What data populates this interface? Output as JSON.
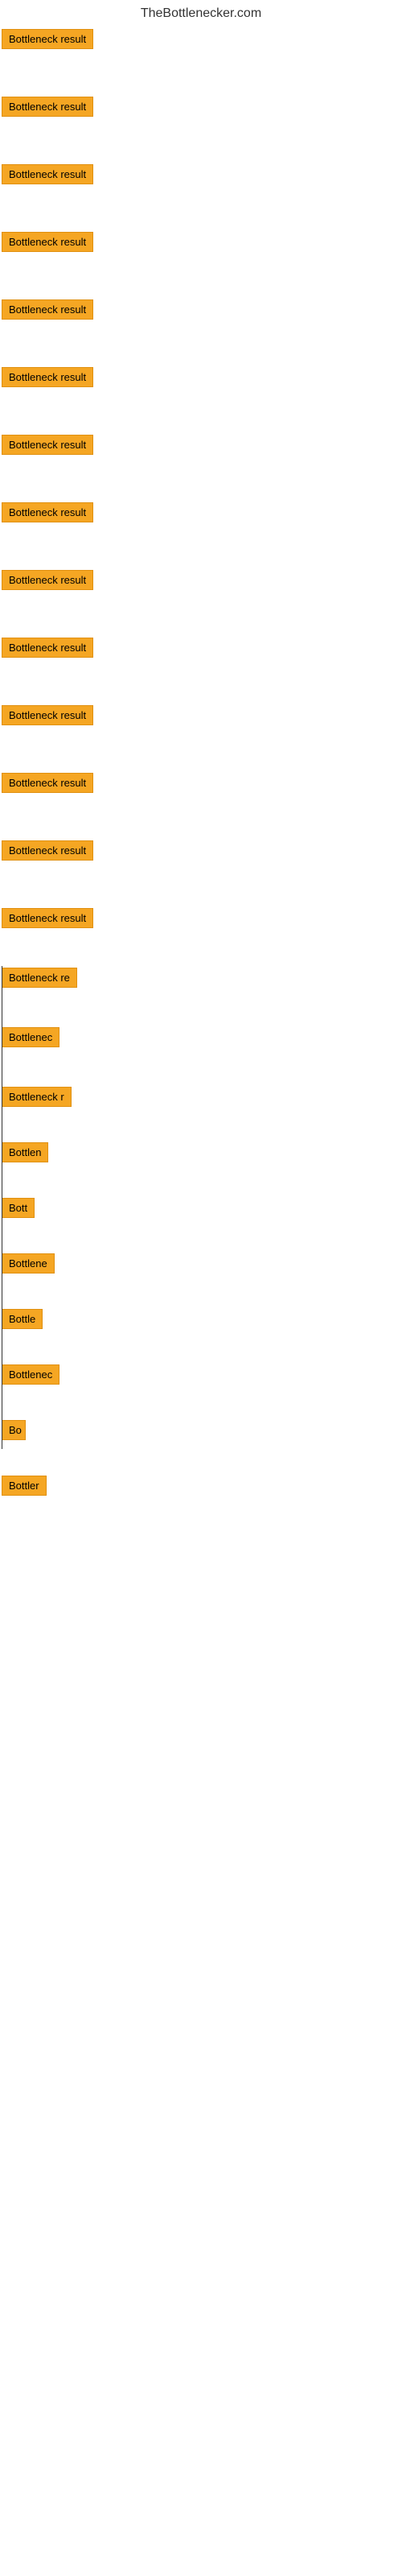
{
  "site": {
    "title": "TheBottlenecker.com"
  },
  "items": [
    {
      "id": 1,
      "label": "Bottleneck result",
      "width": 130
    },
    {
      "id": 2,
      "label": "Bottleneck result",
      "width": 130
    },
    {
      "id": 3,
      "label": "Bottleneck result",
      "width": 130
    },
    {
      "id": 4,
      "label": "Bottleneck result",
      "width": 130
    },
    {
      "id": 5,
      "label": "Bottleneck result",
      "width": 130
    },
    {
      "id": 6,
      "label": "Bottleneck result",
      "width": 130
    },
    {
      "id": 7,
      "label": "Bottleneck result",
      "width": 130
    },
    {
      "id": 8,
      "label": "Bottleneck result",
      "width": 130
    },
    {
      "id": 9,
      "label": "Bottleneck result",
      "width": 130
    },
    {
      "id": 10,
      "label": "Bottleneck result",
      "width": 130
    },
    {
      "id": 11,
      "label": "Bottleneck result",
      "width": 130
    },
    {
      "id": 12,
      "label": "Bottleneck result",
      "width": 130
    },
    {
      "id": 13,
      "label": "Bottleneck result",
      "width": 130
    },
    {
      "id": 14,
      "label": "Bottleneck result",
      "width": 130
    },
    {
      "id": 15,
      "label": "Bottleneck re",
      "width": 110
    },
    {
      "id": 16,
      "label": "Bottlenec",
      "width": 85
    },
    {
      "id": 17,
      "label": "Bottleneck r",
      "width": 95
    },
    {
      "id": 18,
      "label": "Bottlen",
      "width": 70
    },
    {
      "id": 19,
      "label": "Bott",
      "width": 45
    },
    {
      "id": 20,
      "label": "Bottlene",
      "width": 78
    },
    {
      "id": 21,
      "label": "Bottle",
      "width": 55
    },
    {
      "id": 22,
      "label": "Bottlenec",
      "width": 85
    },
    {
      "id": 23,
      "label": "Bo",
      "width": 30
    },
    {
      "id": 24,
      "label": "Bottler",
      "width": 60
    }
  ]
}
